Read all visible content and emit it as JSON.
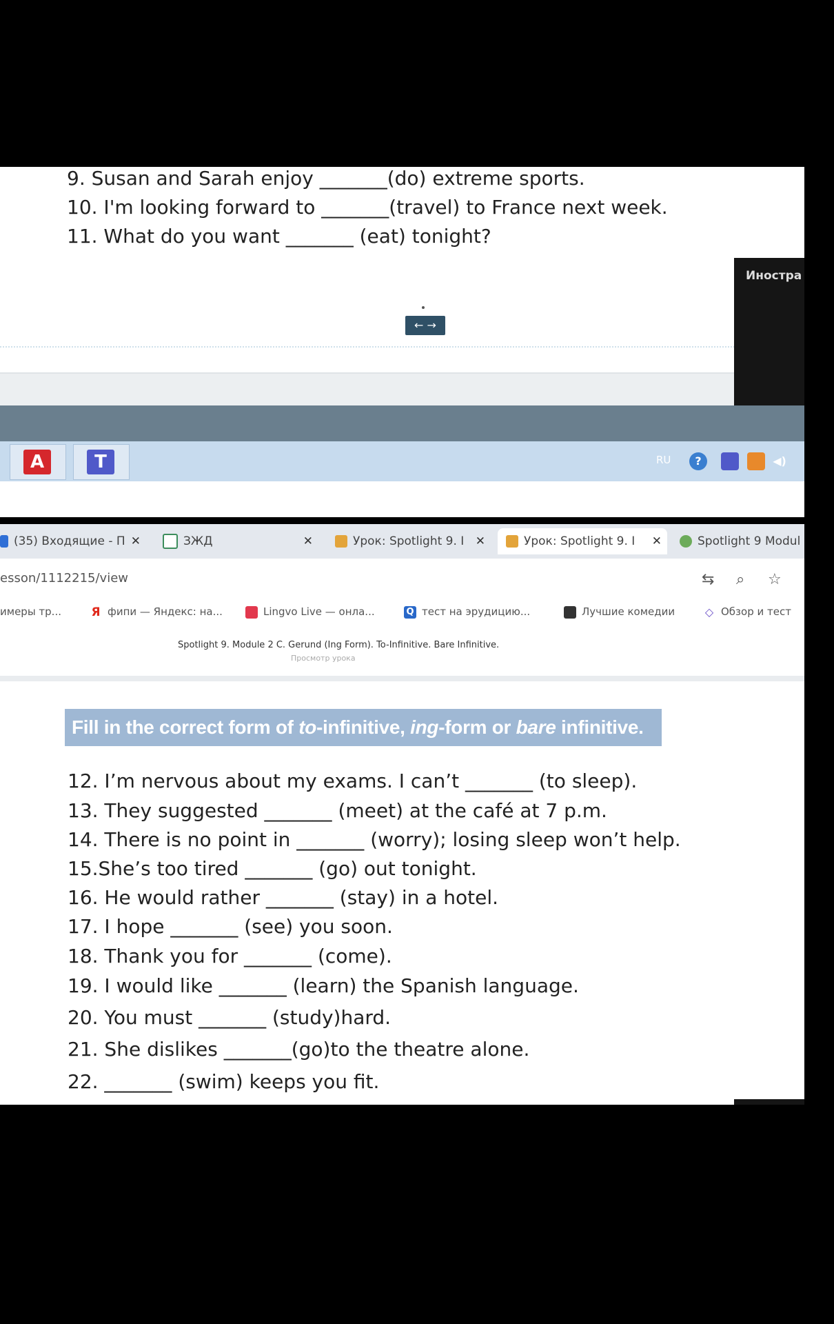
{
  "worksheet_top": {
    "lines": [
      "9. Susan and Sarah enjoy _______(do)  extreme sports.",
      "10. I'm looking forward to _______(travel)  to France next week.",
      "11. What do you want _______  (eat) tonight?"
    ],
    "nav_arrows": "← →"
  },
  "video_overlay": {
    "label": "Иностра"
  },
  "taskbar": {
    "apps": [
      {
        "icon": "acrobat-icon",
        "glyph": "A",
        "color": "#d5272c"
      },
      {
        "icon": "teams-icon",
        "glyph": "T",
        "color": "#5059c9"
      }
    ],
    "tray": {
      "lang": "RU"
    }
  },
  "browser": {
    "tabs": [
      {
        "label": "(35) Входящие - П",
        "close": "✕"
      },
      {
        "label": "ЗЖД",
        "close": "✕"
      },
      {
        "label": "Урок: Spotlight 9. I",
        "close": "✕"
      },
      {
        "label": "Урок: Spotlight 9. I",
        "close": "✕"
      },
      {
        "label": "Spotlight 9 Modul",
        "close": ""
      }
    ],
    "address": "esson/1112215/view",
    "bookmarks": [
      {
        "label": "имеры тр..."
      },
      {
        "label": "фипи — Яндекс: на..."
      },
      {
        "label": "Lingvo Live — онла..."
      },
      {
        "label": "тест на эрудицию..."
      },
      {
        "label": "Лучшие комедии"
      },
      {
        "label": "Обзор и тест"
      }
    ],
    "lesson_title": "Spotlight 9. Module 2 C. Gerund (Ing Form). To-Infinitive. Bare Infinitive.",
    "lesson_sub": "Просмотр урока"
  },
  "worksheet_bottom": {
    "instruction": {
      "p1": "Fill in the correct form of ",
      "i1": "to",
      "p2": "-infinitive, ",
      "i2": "ing",
      "p3": "-form or ",
      "i3": "bare",
      "p4": " infinitive."
    },
    "lines": [
      "12. I’m nervous about my exams. I can’t _______  (to sleep).",
      "13. They suggested _______  (meet) at the café at 7 p.m.",
      "14. There is no point in _______  (worry); losing sleep won’t help.",
      "15.She’s too tired _______  (go) out tonight.",
      "16. He would rather _______  (stay) in a hotel.",
      "17. I hope _______  (see) you soon.",
      "18. Thank you for _______  (come).",
      "19. I would like _______  (learn) the Spanish language.",
      "20. You must _______  (study)hard.",
      "21. She dislikes _______(go)to the theatre alone.",
      "22. _______  (swim) keeps you fit."
    ]
  }
}
